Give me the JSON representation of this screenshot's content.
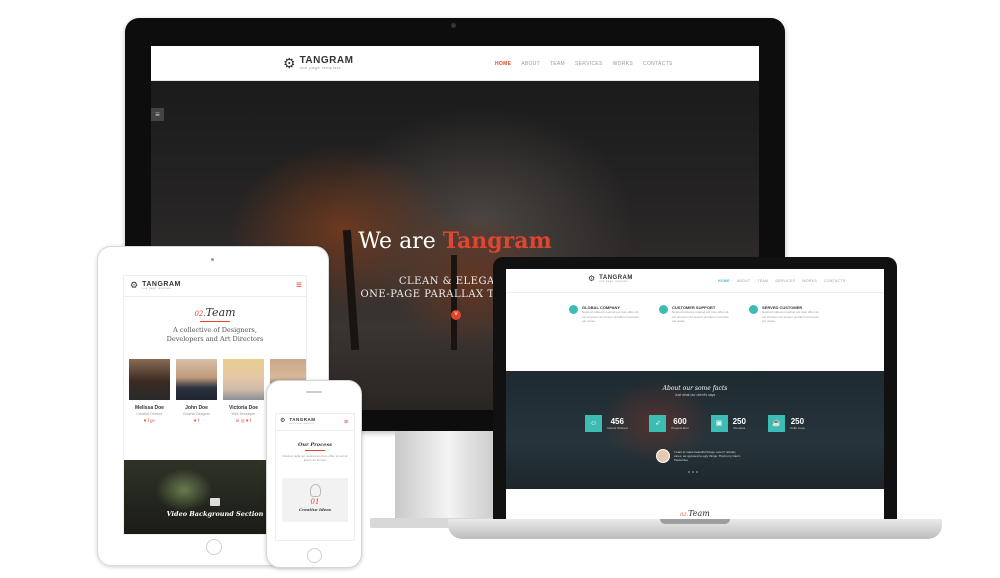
{
  "brand": {
    "name": "TANGRAM",
    "tagline": "one page template"
  },
  "colors": {
    "accent": "#e0452f",
    "teal": "#3dbcb4"
  },
  "desktop": {
    "nav": [
      "HOME",
      "ABOUT",
      "TEAM",
      "SERVICES",
      "WORKS",
      "CONTACTS"
    ],
    "menu_icon": "hamburger-icon",
    "hero_prefix": "We are",
    "hero_name": "Tangram",
    "hero_line1": "CLEAN & ELEGANT",
    "hero_line2": "ONE-PAGE PARALLAX TEMPLATE",
    "scroll_icon": "chevron-down-icon"
  },
  "laptop": {
    "nav": [
      "HOME",
      "ABOUT",
      "TEAM",
      "SERVICES",
      "WORKS",
      "CONTACTS"
    ],
    "features": [
      {
        "title": "GLOBAL COMPANY",
        "desc": "Nostrud nulla qui nostrud est irure offen sit est sit ipsum do tempor proident commodo est occae"
      },
      {
        "title": "CUSTOMER SUPPORT",
        "desc": "Nostrud nulla qui nostrud est irure offen sit est sit ipsum do tempor proident commodo est occae"
      },
      {
        "title": "SERVED CUSTOMER",
        "desc": "Nostrud nulla qui nostrud est irure offen sit est sit ipsum do tempor proident commodo est occae"
      }
    ],
    "facts_title": "About our some facts",
    "facts_sub": "Just what our client's says",
    "counters": [
      {
        "value": "456",
        "label": "Clients Worked",
        "icon": "users-icon"
      },
      {
        "value": "600",
        "label": "Projects Run",
        "icon": "rocket-icon"
      },
      {
        "value": "250",
        "label": "Domains",
        "icon": "briefcase-icon"
      },
      {
        "value": "250",
        "label": "Coffe Cups",
        "icon": "coffee-icon"
      }
    ],
    "testimonial": "I want to make beautiful things, even if nobody cares, as opposed to ugly things. That's my intent.",
    "testimonial_author": "Paula Doe",
    "team_num": "02.",
    "team_title": "Team"
  },
  "tablet": {
    "team_num": "02.",
    "team_title": "Team",
    "desc_line1": "A collective of Designers,",
    "desc_line2": "Developers and Art Directors",
    "members": [
      {
        "name": "Melissa Doe",
        "role": "Creative Director",
        "social": "♥ f g+"
      },
      {
        "name": "John Doe",
        "role": "Graphic Designer",
        "social": "♥ f"
      },
      {
        "name": "Victoria Doe",
        "role": "Web Developer",
        "social": "in ◎ ♥ f"
      },
      {
        "name": "",
        "role": "",
        "social": ""
      }
    ],
    "video_title": "Video Background Section"
  },
  "phone": {
    "process_title": "Our Process",
    "process_desc": "Nostrud nulla qui nostrud est irure offen sit est sit ipsum do tempor",
    "step_num": "01",
    "step_label": "Creative Ideas"
  }
}
